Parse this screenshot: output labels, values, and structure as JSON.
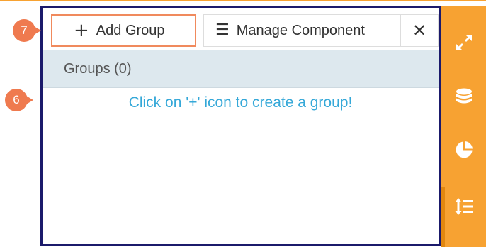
{
  "toolbar": {
    "add_group_label": "Add Group",
    "manage_component_label": "Manage Component",
    "add_icon": "plus-icon",
    "manage_icon": "hamburger-menu-icon",
    "close_icon": "close-icon"
  },
  "groups": {
    "header": "Groups (0)",
    "empty_message": "Click on '+' icon to create a group!"
  },
  "sidebar": {
    "icons": [
      "expand-icon",
      "database-icon",
      "pie-chart-icon",
      "sort-lines-icon"
    ]
  },
  "badges": {
    "badge_7": "7",
    "badge_6": "6"
  },
  "colors": {
    "accent_orange": "#f7a232",
    "panel_border": "#1b1a6b",
    "highlight_border": "#f08a5d",
    "badge": "#ef7a4f",
    "link_text": "#35a8d8",
    "header_bg": "#dde8ee"
  }
}
